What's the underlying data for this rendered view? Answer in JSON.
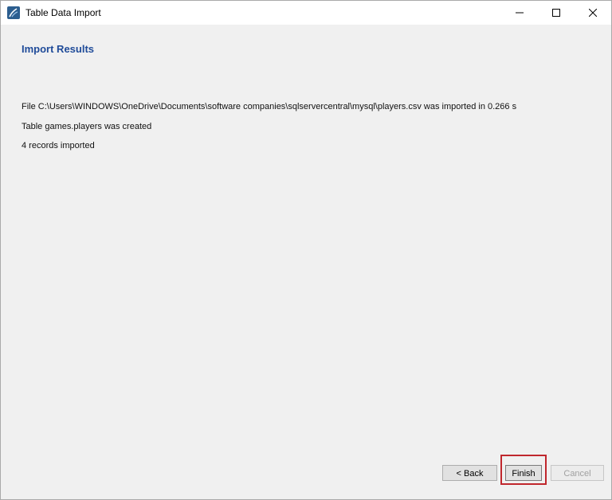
{
  "window": {
    "title": "Table Data Import"
  },
  "page": {
    "heading": "Import Results",
    "messages": [
      "File C:\\Users\\WINDOWS\\OneDrive\\Documents\\software companies\\sqlservercentral\\mysql\\players.csv was imported in 0.266 s",
      "Table games.players was created",
      "4 records imported"
    ]
  },
  "buttons": {
    "back": "< Back",
    "finish": "Finish",
    "cancel": "Cancel"
  },
  "colors": {
    "heading": "#1f4b99",
    "highlight": "#c0272d"
  }
}
